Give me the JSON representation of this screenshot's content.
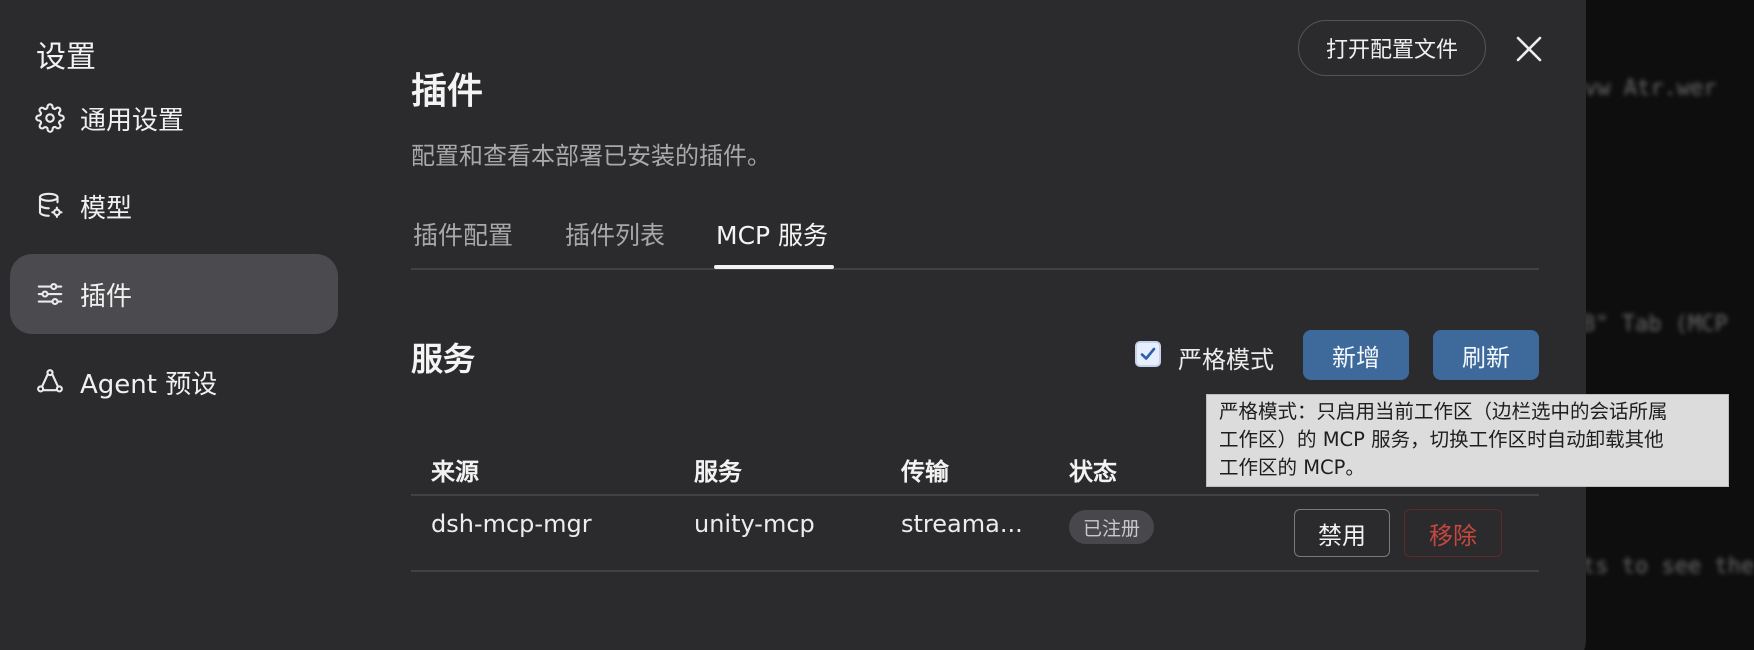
{
  "background_text": [
    " vw Atr.wer",
    "B\" Tab (MCP",
    "ts to see the"
  ],
  "sidebar": {
    "title": "设置",
    "items": [
      {
        "label": "通用设置",
        "icon": "gear-icon"
      },
      {
        "label": "模型",
        "icon": "database-icon"
      },
      {
        "label": "插件",
        "icon": "sliders-icon",
        "active": true
      },
      {
        "label": "Agent 预设",
        "icon": "agent-network-icon"
      }
    ]
  },
  "header": {
    "open_config_label": "打开配置文件",
    "close_icon": "close-icon"
  },
  "main": {
    "title": "插件",
    "description": "配置和查看本部署已安装的插件。",
    "tabs": [
      {
        "label": "插件配置"
      },
      {
        "label": "插件列表"
      },
      {
        "label": "MCP 服务",
        "active": true
      }
    ]
  },
  "services": {
    "title": "服务",
    "strict_mode_label": "严格模式",
    "strict_mode_checked": true,
    "add_label": "新增",
    "refresh_label": "刷新",
    "tooltip_lines": [
      "严格模式：只启用当前工作区（边栏选中的会话所属",
      "工作区）的 MCP 服务，切换工作区时自动卸载其他",
      "工作区的 MCP。"
    ],
    "columns": [
      "来源",
      "服务",
      "传输",
      "状态"
    ],
    "rows": [
      {
        "source": "dsh-mcp-mgr",
        "service": "unity-mcp",
        "transport": "streama...",
        "status": "已注册",
        "disable_label": "禁用",
        "remove_label": "移除"
      }
    ]
  },
  "colors": {
    "modal_bg": "#2b2b2d",
    "accent": "#3e6a9b",
    "danger": "#c7473f"
  }
}
